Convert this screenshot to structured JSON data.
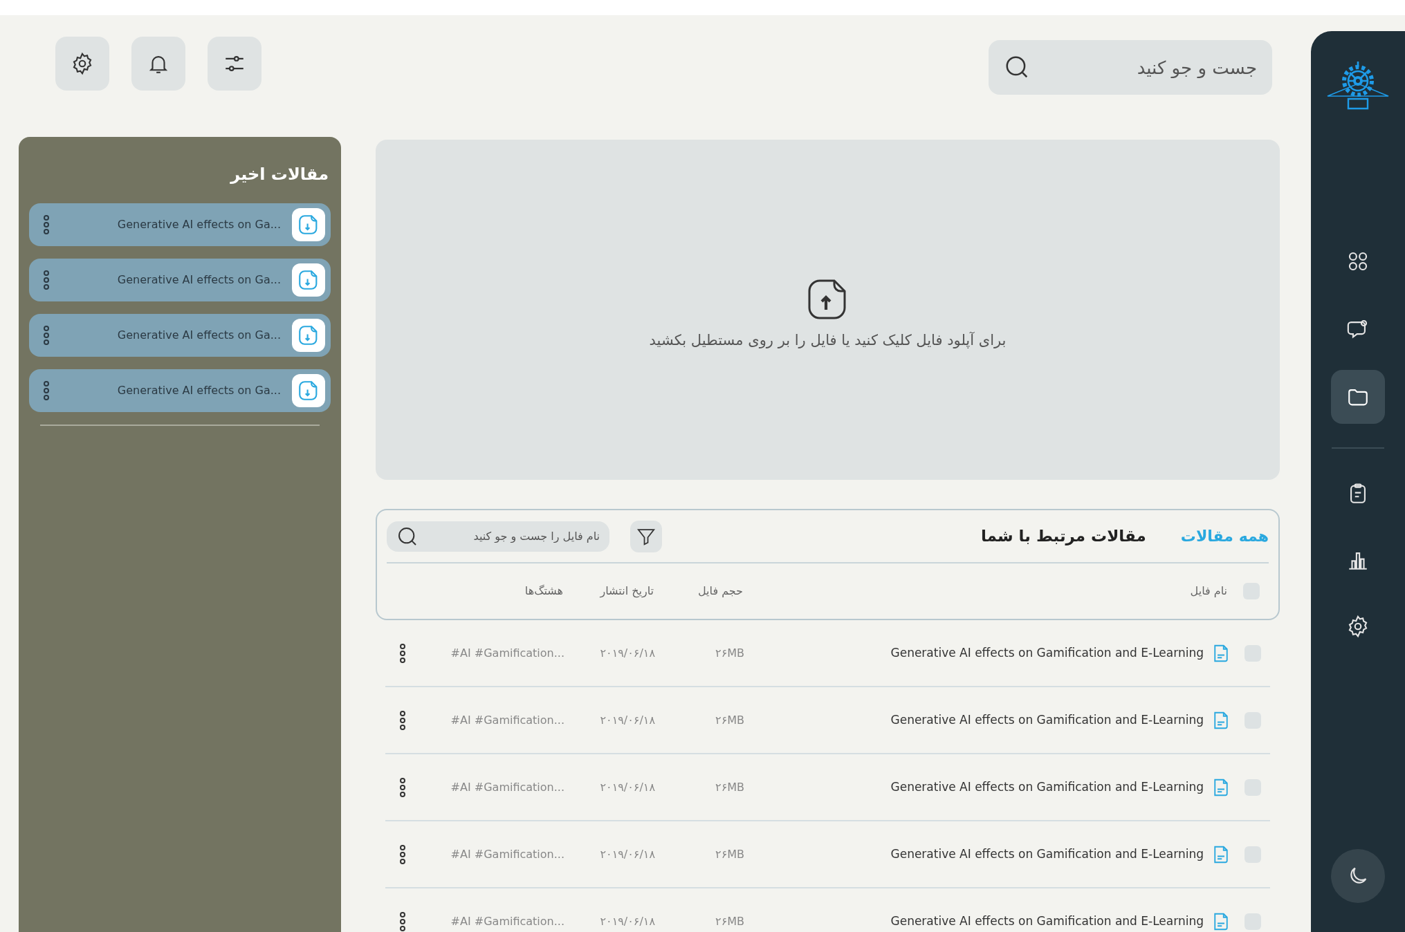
{
  "search": {
    "placeholder": "جست و جو کنید"
  },
  "sidebar": {
    "items": [
      {
        "kind": "apps",
        "selected": false
      },
      {
        "kind": "chat",
        "selected": false
      },
      {
        "kind": "folder",
        "selected": true
      },
      {
        "kind": "clipboard",
        "selected": false
      },
      {
        "kind": "chart",
        "selected": false
      },
      {
        "kind": "settings",
        "selected": false
      }
    ]
  },
  "recent_articles": {
    "title": "مقالات اخیر",
    "items": [
      {
        "name": "Generative AI effects on Ga..."
      },
      {
        "name": "Generative AI effects on Ga..."
      },
      {
        "name": "Generative AI effects on Ga..."
      },
      {
        "name": "Generative AI effects on Ga..."
      }
    ]
  },
  "upload": {
    "text": "برای آپلود فایل کلیک کنید یا فایل را بر روی مستطیل بکشید"
  },
  "related": {
    "title": "مقالات مرتبط با شما",
    "link": "همه مقالات",
    "search": {
      "placeholder": "نام فایل را جست و جو کنید"
    },
    "columns": [
      "نام فایل",
      "حجم فایل",
      "تاریخ انتشار",
      "هشتگ‌ها"
    ],
    "select_all": {
      "checked": false
    },
    "rows": [
      {
        "checked": false,
        "name": "Generative AI effects on Gamification and E-Learning",
        "size": "۲۶MB",
        "date": "۲۰۱۹/۰۶/۱۸",
        "hashtags": "#AI #Gamification..."
      },
      {
        "checked": false,
        "name": "Generative AI effects on Gamification and E-Learning",
        "size": "۲۶MB",
        "date": "۲۰۱۹/۰۶/۱۸",
        "hashtags": "#AI #Gamification..."
      },
      {
        "checked": false,
        "name": "Generative AI effects on Gamification and E-Learning",
        "size": "۲۶MB",
        "date": "۲۰۱۹/۰۶/۱۸",
        "hashtags": "#AI #Gamification..."
      },
      {
        "checked": false,
        "name": "Generative AI effects on Gamification and E-Learning",
        "size": "۲۶MB",
        "date": "۲۰۱۹/۰۶/۱۸",
        "hashtags": "#AI #Gamification..."
      },
      {
        "checked": false,
        "name": "Generative AI effects on Gamification and E-Learning",
        "size": "۲۶MB",
        "date": "۲۰۱۹/۰۶/۱۸",
        "hashtags": "#AI #Gamification..."
      }
    ]
  }
}
